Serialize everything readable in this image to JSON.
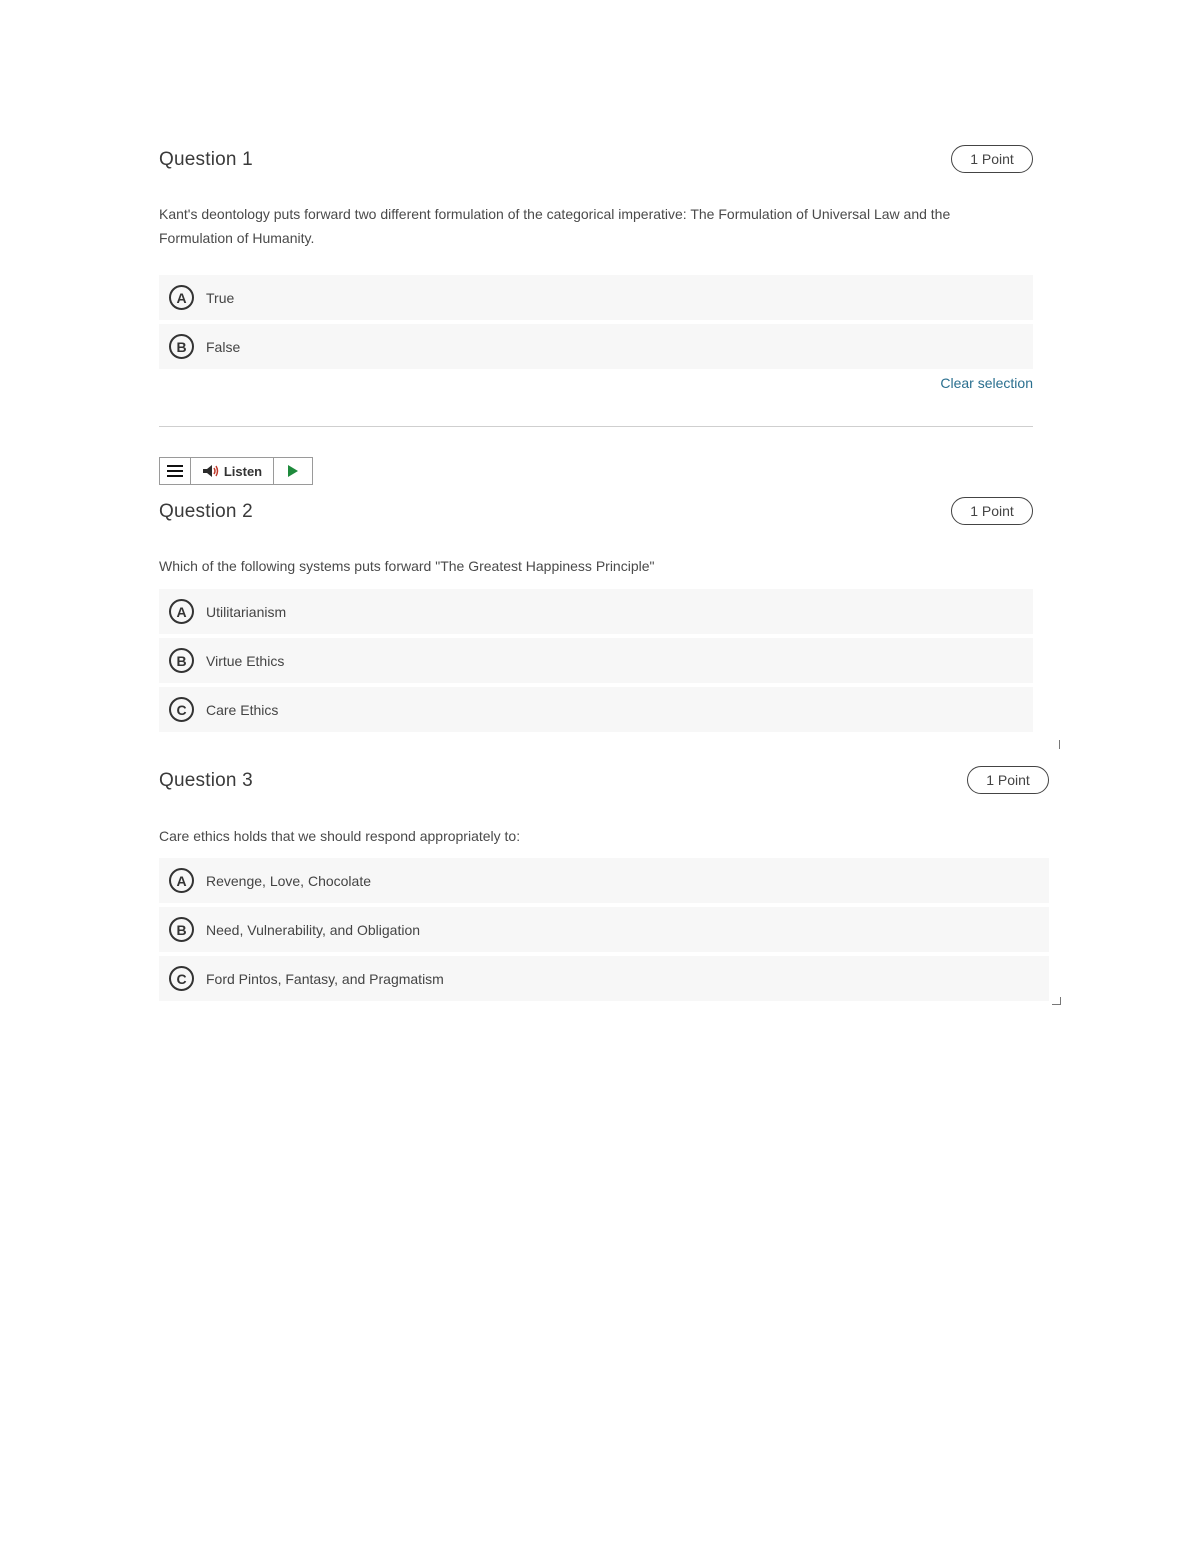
{
  "questions": [
    {
      "title": "Question 1",
      "points": "1 Point",
      "prompt_line1": "Kant's deontology puts forward two different formulation of the categorical imperative: The Formulation of Universal Law and the",
      "prompt_line2": "Formulation of Humanity.",
      "options": [
        {
          "letter": "A",
          "text": "True"
        },
        {
          "letter": "B",
          "text": "False"
        }
      ],
      "clear_selection": "Clear selection"
    },
    {
      "title": "Question 2",
      "points": "1 Point",
      "prompt": "Which of the following systems puts forward \"The Greatest Happiness Principle\"",
      "options": [
        {
          "letter": "A",
          "text": "Utilitarianism"
        },
        {
          "letter": "B",
          "text": "Virtue Ethics"
        },
        {
          "letter": "C",
          "text": "Care Ethics"
        }
      ]
    },
    {
      "title": "Question 3",
      "points": "1 Point",
      "prompt": "Care ethics holds that we should respond appropriately to:",
      "options": [
        {
          "letter": "A",
          "text": "Revenge, Love, Chocolate"
        },
        {
          "letter": "B",
          "text": "Need, Vulnerability, and Obligation"
        },
        {
          "letter": "C",
          "text": "Ford Pintos, Fantasy, and Pragmatism"
        }
      ]
    }
  ],
  "listen_toolbar": {
    "listen_label": "Listen",
    "menu_icon": "hamburger-menu-icon",
    "speaker_icon": "speaker-icon",
    "play_icon": "play-icon",
    "play_color": "#1e8a3c"
  },
  "colors": {
    "link": "#2a6f8f",
    "option_bg": "#f7f7f7"
  }
}
